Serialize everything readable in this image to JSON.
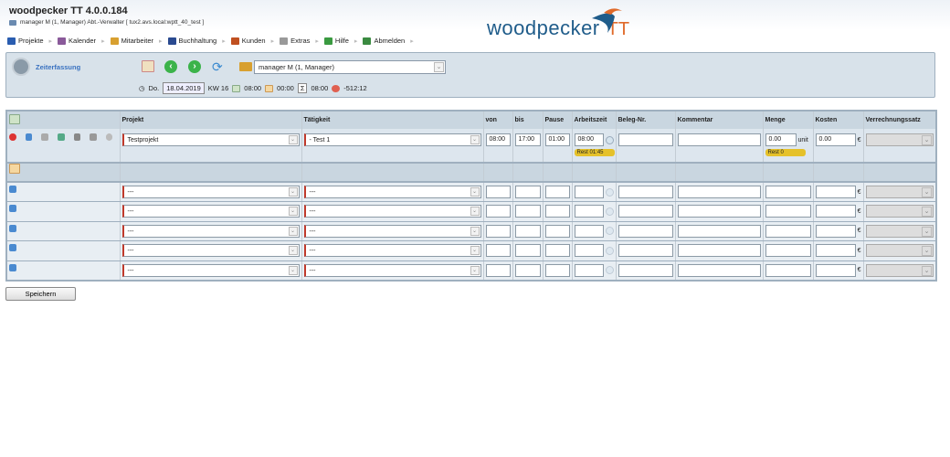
{
  "app": {
    "title": "woodpecker TT 4.0.0.184",
    "user_line": "manager M (1, Manager) Abt.-Verwalter [ tux2.avs.local:wptt_40_test ]",
    "logo_word": "woodpecker",
    "logo_tt": "TT"
  },
  "menu": [
    {
      "label": "Projekte",
      "color": "#2a5db0"
    },
    {
      "label": "Kalender",
      "color": "#8a5a9a"
    },
    {
      "label": "Mitarbeiter",
      "color": "#d8a030"
    },
    {
      "label": "Buchhaltung",
      "color": "#2a4a90"
    },
    {
      "label": "Kunden",
      "color": "#c05020"
    },
    {
      "label": "Extras",
      "color": "#999999"
    },
    {
      "label": "Hilfe",
      "color": "#3a9a40"
    },
    {
      "label": "Abmelden",
      "color": "#3a8a40"
    }
  ],
  "panel": {
    "title": "Zeiterfassung",
    "employee": "manager M (1, Manager)",
    "day": "Do.",
    "date": "18.04.2019",
    "week": "KW 16",
    "soll": "08:00",
    "extra": "00:00",
    "sum": "08:00",
    "balance": "-512:12"
  },
  "table": {
    "headers": [
      "Projekt",
      "Tätigkeit",
      "von",
      "bis",
      "Pause",
      "Arbeitszeit",
      "Beleg-Nr.",
      "Kommentar",
      "Menge",
      "Kosten",
      "Verrechnungssatz"
    ],
    "entry": {
      "projekt": "Testprojekt",
      "taetigkeit": "- Test 1",
      "von": "08:00",
      "bis": "17:00",
      "pause": "01:00",
      "arbeitszeit": "08:00",
      "rest_time": "Rest 01:45",
      "beleg": "",
      "kommentar": "",
      "menge": "0.00",
      "unit": "unit",
      "kosten": "0.00",
      "currency": "€",
      "rest_menge": "Rest 0"
    },
    "empty_rows": [
      {
        "projekt": "---",
        "taetigkeit": "---"
      },
      {
        "projekt": "---",
        "taetigkeit": "---"
      },
      {
        "projekt": "---",
        "taetigkeit": "---"
      },
      {
        "projekt": "---",
        "taetigkeit": "---"
      },
      {
        "projekt": "---",
        "taetigkeit": "---"
      }
    ]
  },
  "save_label": "Speichern"
}
